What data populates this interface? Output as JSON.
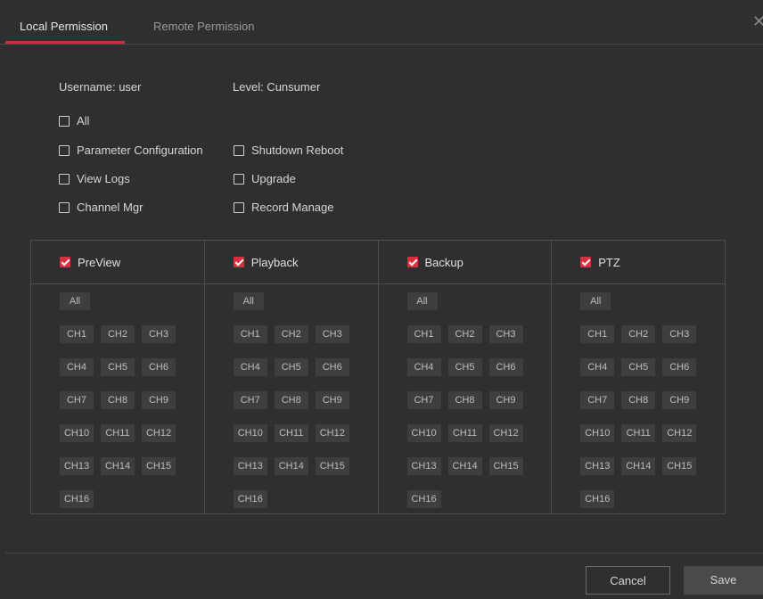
{
  "tabs": [
    {
      "label": "Local Permission",
      "active": true
    },
    {
      "label": "Remote Permission",
      "active": false
    }
  ],
  "close_glyph": "✕",
  "user": {
    "username_label": "Username: user",
    "level_label": "Level: Cunsumer"
  },
  "permissions": {
    "all": {
      "label": "All",
      "checked": false
    },
    "left": [
      {
        "label": "Parameter Configuration",
        "checked": false
      },
      {
        "label": "View Logs",
        "checked": false
      },
      {
        "label": "Channel Mgr",
        "checked": false
      }
    ],
    "right": [
      {
        "label": "Shutdown Reboot",
        "checked": false
      },
      {
        "label": "Upgrade",
        "checked": false
      },
      {
        "label": "Record Manage",
        "checked": false
      }
    ]
  },
  "categories": [
    {
      "label": "PreView",
      "checked": true
    },
    {
      "label": "Playback",
      "checked": true
    },
    {
      "label": "Backup",
      "checked": true
    },
    {
      "label": "PTZ",
      "checked": true
    }
  ],
  "channel_all_label": "All",
  "channels": [
    "CH1",
    "CH2",
    "CH3",
    "CH4",
    "CH5",
    "CH6",
    "CH7",
    "CH8",
    "CH9",
    "CH10",
    "CH11",
    "CH12",
    "CH13",
    "CH14",
    "CH15",
    "CH16"
  ],
  "buttons": {
    "cancel": "Cancel",
    "save": "Save"
  },
  "colors": {
    "accent": "#d8303d",
    "background": "#2f2f31",
    "chip": "#3e3e40"
  }
}
